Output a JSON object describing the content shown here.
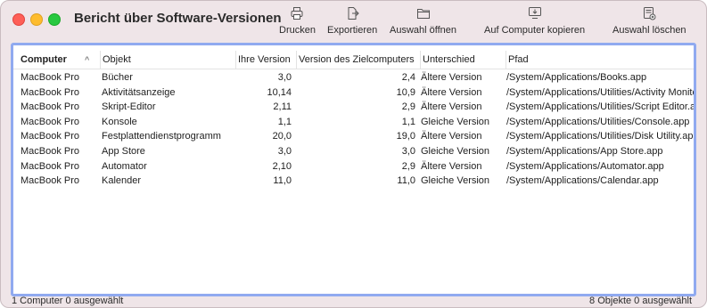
{
  "window": {
    "title": "Bericht über Software-Versionen"
  },
  "toolbar": {
    "print_label": "Drucken",
    "export_label": "Exportieren",
    "open_label": "Auswahl öffnen",
    "copy_label": "Auf Computer kopieren",
    "delete_label": "Auswahl löschen",
    "icons": [
      "printer-icon",
      "export-icon",
      "folder-icon",
      "computer-icon",
      "delete-icon"
    ]
  },
  "table": {
    "headers": [
      "Computer",
      "Objekt",
      "Ihre Version",
      "Version des Zielcomputers",
      "Unterschied",
      "Pfad"
    ],
    "sort_indicator": "^",
    "rows": [
      [
        "MacBook Pro",
        "Bücher",
        "3,0",
        "2,4",
        "Ältere Version",
        "/System/Applications/Books.app"
      ],
      [
        "MacBook Pro",
        "Aktivitätsanzeige",
        "10,14",
        "10,9",
        "Ältere Version",
        "/System/Applications/Utilities/Activity Monitor.app"
      ],
      [
        "MacBook Pro",
        "Skript-Editor",
        "2,11",
        "2,9",
        "Ältere Version",
        "/System/Applications/Utilities/Script Editor.app"
      ],
      [
        "MacBook Pro",
        "Konsole",
        "1,1",
        "1,1",
        "Gleiche Version",
        "/System/Applications/Utilities/Console.app"
      ],
      [
        "MacBook Pro",
        "Festplattendienstprogramm",
        "20,0",
        "19,0",
        "Ältere Version",
        "/System/Applications/Utilities/Disk Utility.app"
      ],
      [
        "MacBook Pro",
        "App Store",
        "3,0",
        "3,0",
        "Gleiche Version",
        "/System/Applications/App Store.app"
      ],
      [
        "MacBook Pro",
        "Automator",
        "2,10",
        "2,9",
        "Ältere Version",
        "/System/Applications/Automator.app"
      ],
      [
        "MacBook Pro",
        "Kalender",
        "11,0",
        "11,0",
        "Gleiche Version",
        "/System/Applications/Calendar.app"
      ]
    ]
  },
  "status": {
    "left": "1 Computer   0 ausgewählt",
    "right": "8 Objekte   0 ausgewählt"
  },
  "colors": {
    "window_bg": "#efe5e8",
    "focus_ring": "#90aaf0",
    "close": "#fe5f57",
    "minimize": "#febc2e",
    "zoom": "#28c840"
  }
}
